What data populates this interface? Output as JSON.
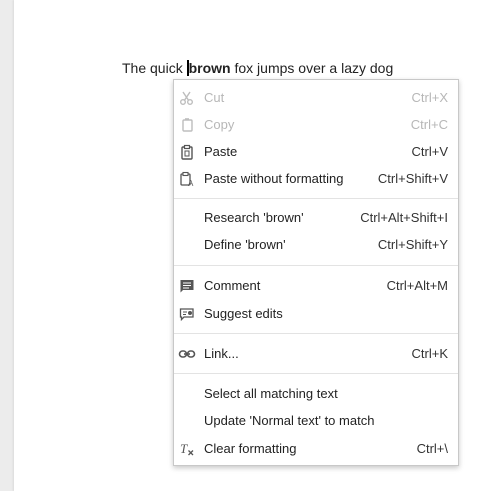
{
  "document": {
    "text_before": "The quick ",
    "selected_word": "brown",
    "text_after": " fox jumps over a lazy dog"
  },
  "context_menu": {
    "items": [
      {
        "label": "Cut",
        "shortcut": "Ctrl+X",
        "icon": "scissors-icon",
        "enabled": false
      },
      {
        "label": "Copy",
        "shortcut": "Ctrl+C",
        "icon": "copy-icon",
        "enabled": false
      },
      {
        "label": "Paste",
        "shortcut": "Ctrl+V",
        "icon": "clipboard-icon",
        "enabled": true
      },
      {
        "label": "Paste without formatting",
        "shortcut": "Ctrl+Shift+V",
        "icon": "clipboard-text-icon",
        "enabled": true
      },
      {
        "label": "Research 'brown'",
        "shortcut": "Ctrl+Alt+Shift+I",
        "icon": "",
        "enabled": true
      },
      {
        "label": "Define 'brown'",
        "shortcut": "Ctrl+Shift+Y",
        "icon": "",
        "enabled": true
      },
      {
        "label": "Comment",
        "shortcut": "Ctrl+Alt+M",
        "icon": "comment-icon",
        "enabled": true
      },
      {
        "label": "Suggest edits",
        "shortcut": "",
        "icon": "suggest-edits-icon",
        "enabled": true
      },
      {
        "label": "Link...",
        "shortcut": "Ctrl+K",
        "icon": "link-icon",
        "enabled": true
      },
      {
        "label": "Select all matching text",
        "shortcut": "",
        "icon": "",
        "enabled": true
      },
      {
        "label": "Update 'Normal text' to match",
        "shortcut": "",
        "icon": "",
        "enabled": true
      },
      {
        "label": "Clear formatting",
        "shortcut": "Ctrl+\\",
        "icon": "clear-formatting-icon",
        "enabled": true
      }
    ]
  },
  "colors": {
    "disabled_text": "#b7b7b7",
    "menu_border": "#c8c8c8",
    "icon": "#555555"
  }
}
